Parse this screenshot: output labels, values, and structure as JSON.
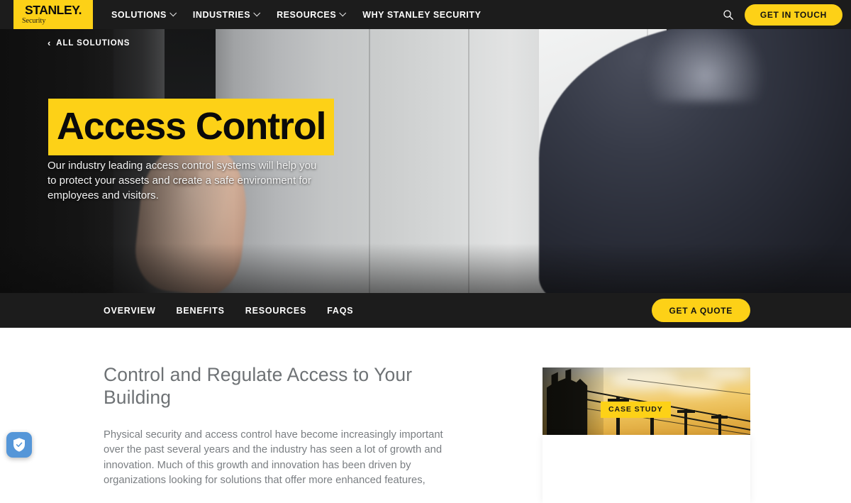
{
  "brand": {
    "logo_word": "STANLEY.",
    "logo_sub": "Security",
    "accent_yellow": "#FDD117",
    "dark_bar": "#1C1C1C"
  },
  "topnav": {
    "items": [
      {
        "label": "SOLUTIONS",
        "has_dropdown": true
      },
      {
        "label": "INDUSTRIES",
        "has_dropdown": true
      },
      {
        "label": "RESOURCES",
        "has_dropdown": true
      },
      {
        "label": "WHY STANLEY SECURITY",
        "has_dropdown": false
      }
    ],
    "search_icon": "search-icon",
    "cta_label": "GET IN TOUCH"
  },
  "hero": {
    "breadcrumb_arrow": "‹",
    "breadcrumb_label": "ALL SOLUTIONS",
    "title": "Access Control",
    "subtitle": "Our industry leading access control systems will help you to protect your assets and create a safe environment for employees and visitors."
  },
  "subnav": {
    "items": [
      {
        "label": "OVERVIEW"
      },
      {
        "label": "BENEFITS"
      },
      {
        "label": "RESOURCES"
      },
      {
        "label": "FAQS"
      }
    ],
    "quote_label": "GET A QUOTE"
  },
  "main": {
    "section_title": "Control and Regulate Access to Your Building",
    "body_text": "Physical security and access control have become increasingly important over the past several years and the industry has seen a lot of growth and innovation. Much of this growth and innovation has been driven by organizations looking for solutions that offer more enhanced features,",
    "case_badge": "CASE STUDY"
  },
  "cookie": {
    "icon": "shield-check-icon",
    "color": "#5596D8"
  }
}
